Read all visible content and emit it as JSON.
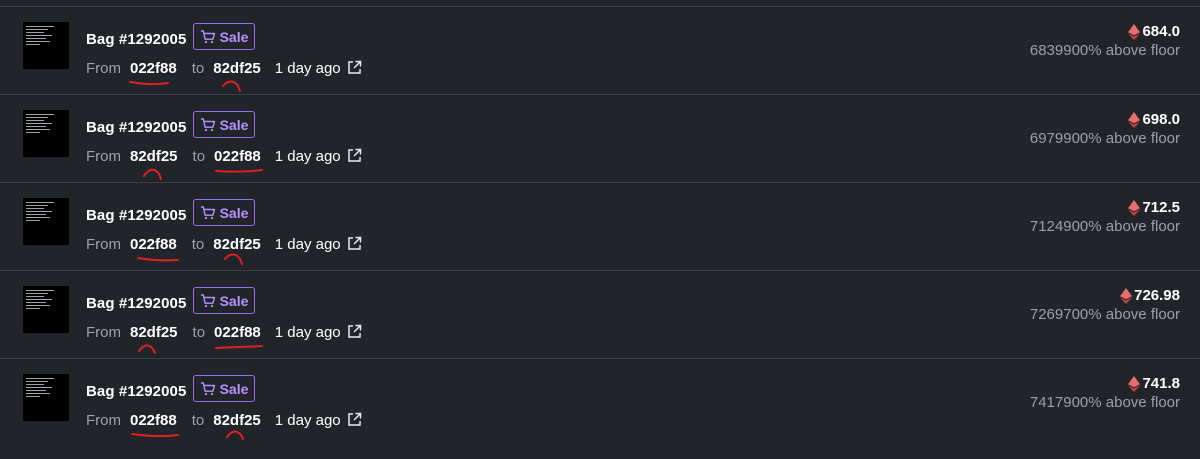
{
  "colors": {
    "background": "#212429",
    "divider": "#3a3e45",
    "sale_accent": "#9b6bf0",
    "eth_icon": "#e15b5b",
    "annotation": "#e02020"
  },
  "icons": {
    "sale": "cart-icon",
    "currency": "eth-icon",
    "link": "external-link-icon"
  },
  "labels": {
    "from": "From",
    "to": "to"
  },
  "sales": [
    {
      "name": "Bag #1292005",
      "badge": "Sale",
      "from": "022f88",
      "to": "82df25",
      "time": "1 day ago",
      "price": "684.0",
      "floor": "6839900% above floor"
    },
    {
      "name": "Bag #1292005",
      "badge": "Sale",
      "from": "82df25",
      "to": "022f88",
      "time": "1 day ago",
      "price": "698.0",
      "floor": "6979900% above floor"
    },
    {
      "name": "Bag #1292005",
      "badge": "Sale",
      "from": "022f88",
      "to": "82df25",
      "time": "1 day ago",
      "price": "712.5",
      "floor": "7124900% above floor"
    },
    {
      "name": "Bag #1292005",
      "badge": "Sale",
      "from": "82df25",
      "to": "022f88",
      "time": "1 day ago",
      "price": "726.98",
      "floor": "7269700% above floor"
    },
    {
      "name": "Bag #1292005",
      "badge": "Sale",
      "from": "022f88",
      "to": "82df25",
      "time": "1 day ago",
      "price": "741.8",
      "floor": "7417900% above floor"
    }
  ]
}
